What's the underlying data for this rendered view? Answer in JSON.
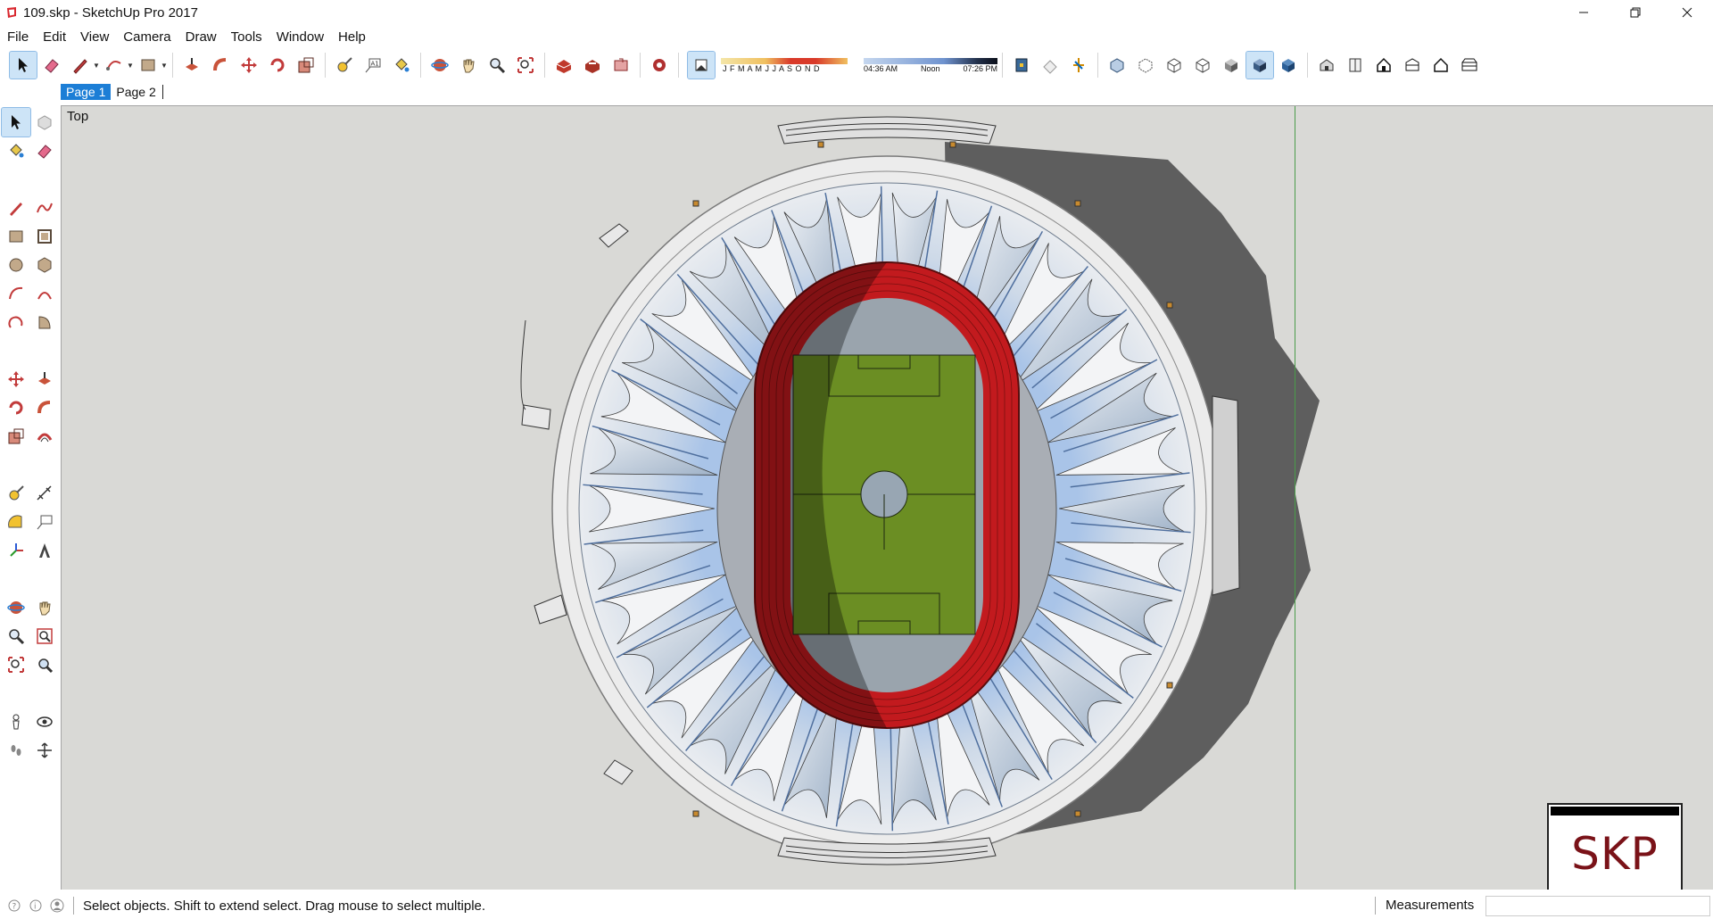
{
  "window": {
    "title": "109.skp - SketchUp Pro 2017",
    "controls": [
      "minimize-icon",
      "restore-icon",
      "close-icon"
    ]
  },
  "menu": [
    "File",
    "Edit",
    "View",
    "Camera",
    "Draw",
    "Tools",
    "Window",
    "Help"
  ],
  "toolbar": {
    "shadow_months": "J F M A M J J A S O N D",
    "shadow_times": [
      "04:36 AM",
      "Noon",
      "07:26 PM"
    ]
  },
  "tabs": [
    "Page 1",
    "Page 2"
  ],
  "viewport": {
    "view_name": "Top",
    "badge": "SKP"
  },
  "status": {
    "message": "Select objects. Shift to extend select. Drag mouse to select multiple.",
    "measurements_label": "Measurements",
    "measurements_value": ""
  },
  "colors": {
    "viewport_bg": "#d9d9d6",
    "track_red": "#c21a1e",
    "pitch_green": "#6b8e23",
    "accent_blue": "#1c7ed6",
    "green_axis": "#4a9d4a"
  }
}
